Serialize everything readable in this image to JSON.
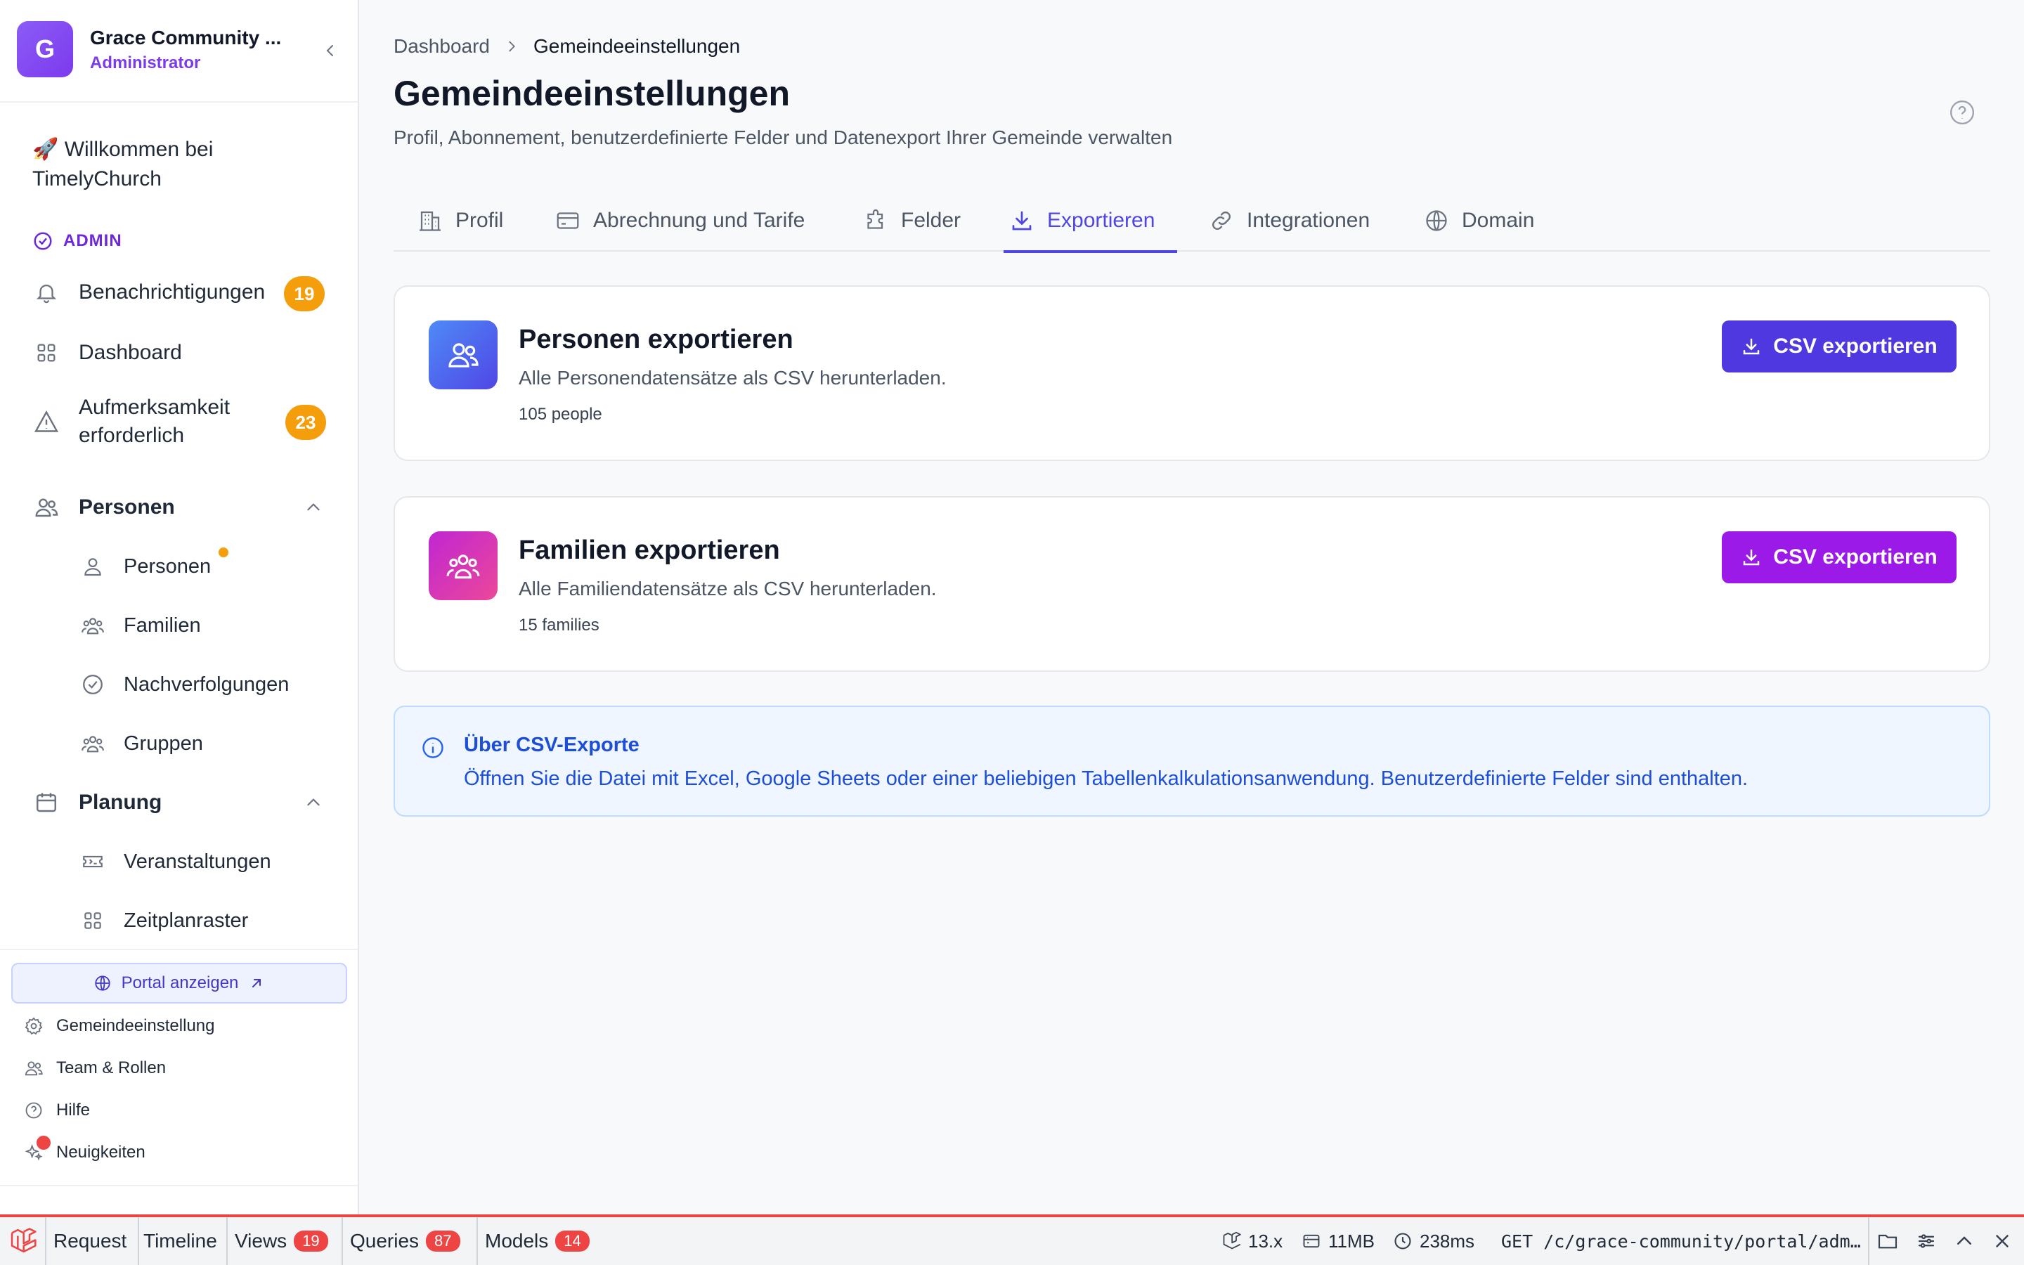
{
  "sidebar": {
    "org_initial": "G",
    "org_name": "Grace Community ...",
    "org_role": "Administrator",
    "welcome": "🚀 Willkommen bei TimelyChurch",
    "admin_label": "ADMIN",
    "nav": {
      "notifications": {
        "label": "Benachrichtigungen",
        "badge": "19"
      },
      "dashboard": {
        "label": "Dashboard"
      },
      "attention": {
        "label_line1": "Aufmerksamkeit",
        "label_line2": "erforderlich",
        "badge": "23"
      },
      "people_section": {
        "label": "Personen"
      },
      "people": {
        "label": "Personen"
      },
      "families": {
        "label": "Familien"
      },
      "followups": {
        "label": "Nachverfolgungen"
      },
      "groups": {
        "label": "Gruppen"
      },
      "planning_section": {
        "label": "Planung"
      },
      "events": {
        "label": "Veranstaltungen"
      },
      "schedule": {
        "label": "Zeitplanraster"
      }
    },
    "portal_button": "Portal anzeigen",
    "footer": {
      "settings": "Gemeindeeinstellung",
      "team": "Team & Rollen",
      "help": "Hilfe",
      "news": "Neuigkeiten"
    }
  },
  "breadcrumb": {
    "root": "Dashboard",
    "current": "Gemeindeeinstellungen"
  },
  "page": {
    "title": "Gemeindeeinstellungen",
    "subtitle": "Profil, Abonnement, benutzerdefinierte Felder und Datenexport Ihrer Gemeinde verwalten"
  },
  "tabs": [
    {
      "label": "Profil",
      "icon": "building-icon"
    },
    {
      "label": "Abrechnung und Tarife",
      "icon": "credit-card-icon"
    },
    {
      "label": "Felder",
      "icon": "puzzle-icon"
    },
    {
      "label": "Exportieren",
      "icon": "download-icon",
      "active": true
    },
    {
      "label": "Integrationen",
      "icon": "link-icon"
    },
    {
      "label": "Domain",
      "icon": "globe-icon"
    }
  ],
  "export_cards": {
    "people": {
      "title": "Personen exportieren",
      "description": "Alle Personendatensätze als CSV herunterladen.",
      "count": "105 people",
      "button": "CSV exportieren",
      "icon_color": "#4f6ef7",
      "button_color": "#4f38e0"
    },
    "families": {
      "title": "Familien exportieren",
      "description": "Alle Familiendatensätze als CSV herunterladen.",
      "count": "15 families",
      "button": "CSV exportieren",
      "icon_color": "#d946ef",
      "button_color": "#9b1ae8"
    }
  },
  "info": {
    "title": "Über CSV-Exporte",
    "text": "Öffnen Sie die Datei mit Excel, Google Sheets oder einer beliebigen Tabellenkalkulationsanwendung. Benutzerdefinierte Felder sind enthalten."
  },
  "debugbar": {
    "request": "Request",
    "timeline": "Timeline",
    "views": "Views",
    "views_count": "19",
    "queries": "Queries",
    "queries_count": "87",
    "models": "Models",
    "models_count": "14",
    "version": "13.x",
    "memory": "11MB",
    "time": "238ms",
    "route": "GET /c/grace-community/portal/adm…"
  }
}
